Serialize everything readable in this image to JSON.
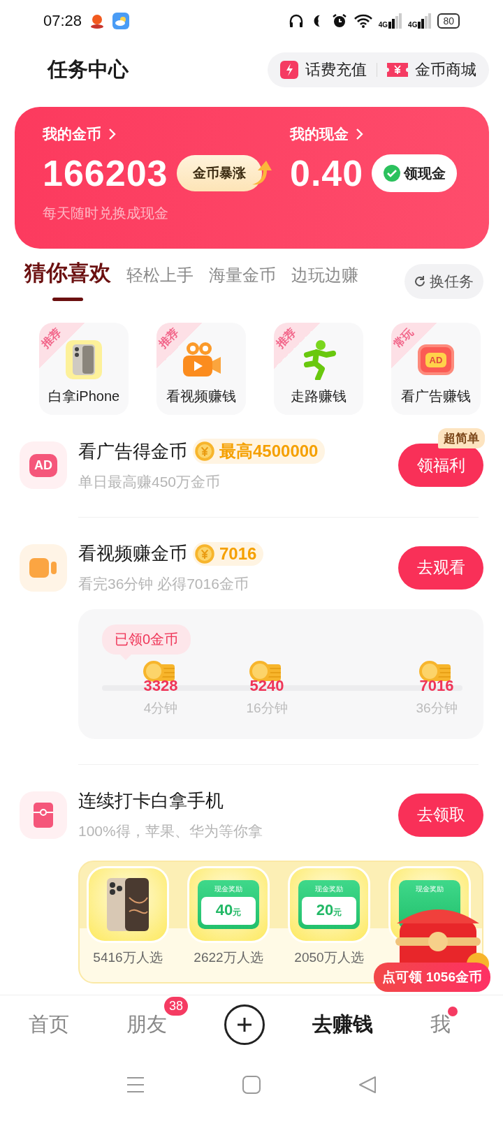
{
  "status_bar": {
    "time": "07:28",
    "signals": [
      {
        "label": "4G"
      },
      {
        "label": "4G"
      }
    ],
    "battery": "80"
  },
  "header": {
    "title": "任务中心",
    "links": [
      {
        "kind": "recharge",
        "label": "话费充值"
      },
      {
        "kind": "mall",
        "label": "金币商城"
      }
    ]
  },
  "wallet": {
    "coins_label": "我的金币",
    "coins": "166203",
    "coins_badge": "金币暴涨",
    "cash_label": "我的现金",
    "cash": "0.40",
    "cash_button": "领现金",
    "note": "每天随时兑换成现金"
  },
  "tabs": [
    {
      "label": "猜你喜欢",
      "selected": true
    },
    {
      "label": "轻松上手",
      "selected": false
    },
    {
      "label": "海量金币",
      "selected": false
    },
    {
      "label": "边玩边赚",
      "selected": false
    }
  ],
  "change_tasks": "换任务",
  "shortcuts": [
    {
      "kind": "phone",
      "tag": "推荐",
      "label": "白拿iPhone"
    },
    {
      "kind": "video",
      "tag": "推荐",
      "label": "看视频赚钱"
    },
    {
      "kind": "walk",
      "tag": "推荐",
      "label": "走路赚钱"
    },
    {
      "kind": "ad",
      "tag": "常玩",
      "label": "看广告赚钱",
      "icon_text": "AD"
    }
  ],
  "tasks": [
    {
      "kind": "ad",
      "icon_text": "AD",
      "title": "看广告得金币",
      "reward": "最高4500000",
      "subtitle": "单日最高赚450万金币",
      "button": "领福利",
      "badge": "超简单"
    },
    {
      "kind": "video",
      "title": "看视频赚金币",
      "reward": "7016",
      "subtitle": "看完36分钟 必得7016金币",
      "button": "去观看",
      "progress": {
        "claimed": "已领0金币",
        "level": 0,
        "milestones": [
          {
            "coins": "3328",
            "time": "4分钟"
          },
          {
            "coins": "5240",
            "time": "16分钟"
          },
          {
            "coins": "7016",
            "time": "36分钟"
          }
        ]
      }
    },
    {
      "kind": "checkin",
      "title": "连续打卡白拿手机",
      "subtitle": "100%得，苹果、华为等你拿",
      "button": "去领取",
      "prizes": [
        {
          "kind": "phone",
          "count": "5416万人选"
        },
        {
          "kind": "cash",
          "caption": "现金奖励",
          "amount": "40",
          "unit": "元",
          "count": "2622万人选"
        },
        {
          "kind": "cash",
          "caption": "现金奖励",
          "amount": "20",
          "unit": "元",
          "count": "2050万人选"
        },
        {
          "kind": "cash",
          "caption": "现金奖励"
        }
      ],
      "chest_label": "点可领 1056金币"
    }
  ],
  "bottom_nav": [
    {
      "kind": "text",
      "label": "首页",
      "selected": false
    },
    {
      "kind": "text",
      "label": "朋友",
      "selected": false,
      "badge": "38"
    },
    {
      "kind": "add"
    },
    {
      "kind": "text",
      "label": "去赚钱",
      "selected": true
    },
    {
      "kind": "text",
      "label": "我",
      "selected": false,
      "dot": true
    }
  ]
}
